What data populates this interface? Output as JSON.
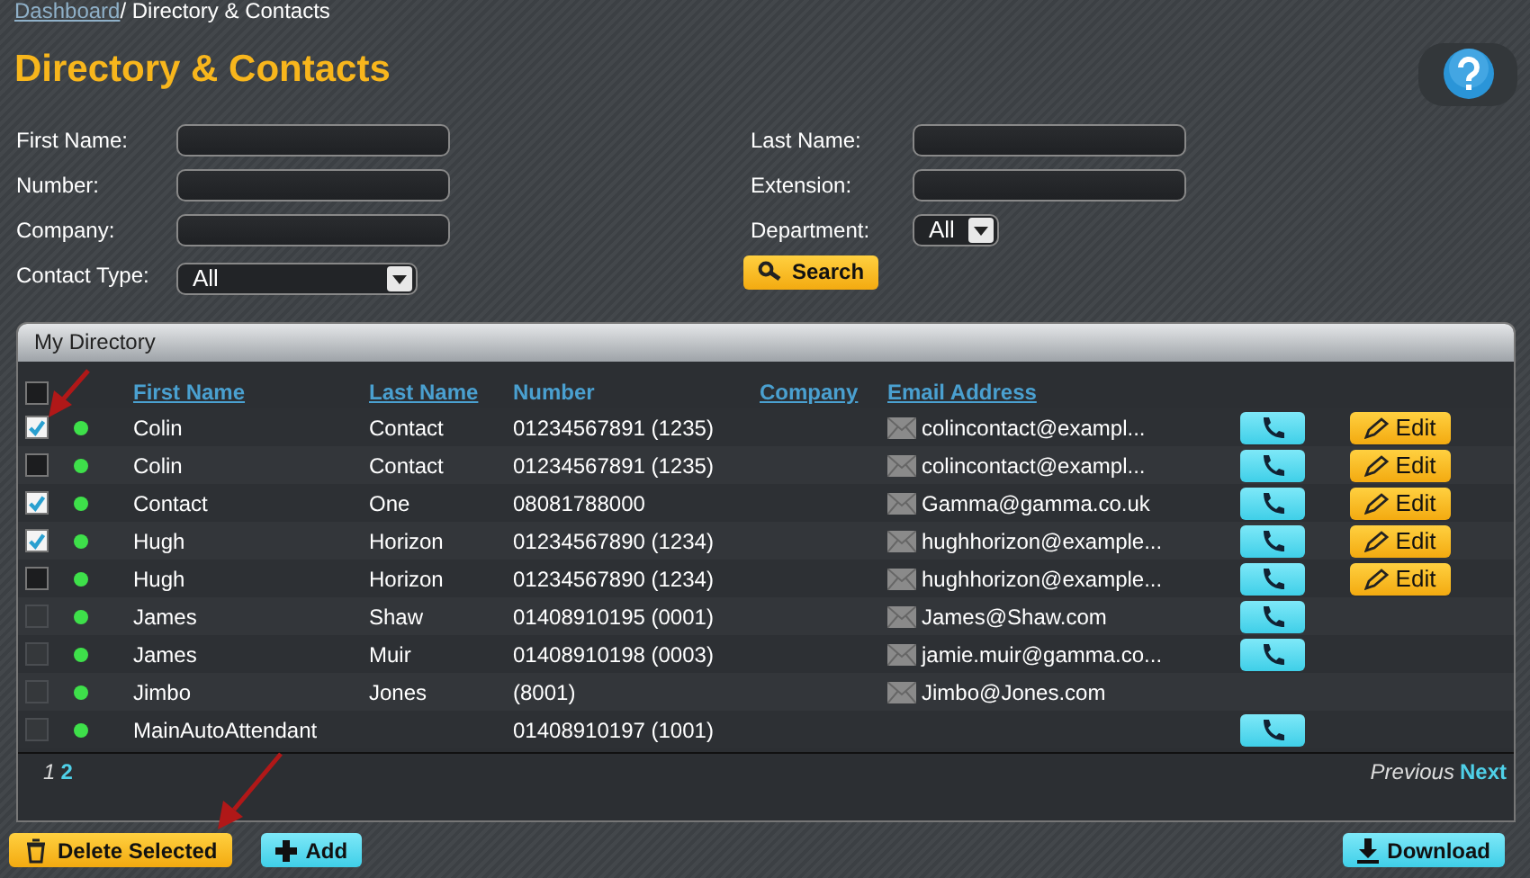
{
  "breadcrumb": {
    "link": "Dashboard",
    "current": "/ Directory & Contacts"
  },
  "title": "Directory & Contacts",
  "filters_left": [
    {
      "label": "First Name:",
      "kind": "text"
    },
    {
      "label": "Number:",
      "kind": "text"
    },
    {
      "label": "Company:",
      "kind": "text"
    },
    {
      "label": "Contact Type:",
      "kind": "select",
      "value": "All"
    }
  ],
  "filters_right": [
    {
      "label": "Last Name:",
      "kind": "text"
    },
    {
      "label": "Extension:",
      "kind": "text"
    },
    {
      "label": "Department:",
      "kind": "select",
      "value": "All"
    }
  ],
  "search_button": "Search",
  "panel": {
    "title": "My Directory",
    "select_all_checked": false,
    "columns": [
      {
        "label": "First Name",
        "link": true
      },
      {
        "label": "Last Name",
        "link": true
      },
      {
        "label": "Number",
        "link": false
      },
      {
        "label": "Company",
        "link": true
      },
      {
        "label": "Email Address",
        "link": true
      }
    ],
    "rows": [
      {
        "checked": true,
        "disabled": false,
        "online": true,
        "first": "Colin",
        "last": "Contact",
        "number": "01234567891 (1235)",
        "email": "colincontact@exampl...",
        "call": true,
        "edit": "Edit"
      },
      {
        "checked": false,
        "disabled": false,
        "online": true,
        "first": "Colin",
        "last": "Contact",
        "number": "01234567891 (1235)",
        "email": "colincontact@exampl...",
        "call": true,
        "edit": "Edit"
      },
      {
        "checked": true,
        "disabled": false,
        "online": true,
        "first": "Contact",
        "last": "One",
        "number": "08081788000",
        "email": "Gamma@gamma.co.uk",
        "call": true,
        "edit": "Edit"
      },
      {
        "checked": true,
        "disabled": false,
        "online": true,
        "first": "Hugh",
        "last": "Horizon",
        "number": "01234567890 (1234)",
        "email": "hughhorizon@example...",
        "call": true,
        "edit": "Edit"
      },
      {
        "checked": false,
        "disabled": false,
        "online": true,
        "first": "Hugh",
        "last": "Horizon",
        "number": "01234567890 (1234)",
        "email": "hughhorizon@example...",
        "call": true,
        "edit": "Edit"
      },
      {
        "checked": false,
        "disabled": true,
        "online": true,
        "first": "James",
        "last": "Shaw",
        "number": "01408910195 (0001)",
        "email": "James@Shaw.com",
        "call": true
      },
      {
        "checked": false,
        "disabled": true,
        "online": true,
        "first": "James",
        "last": "Muir",
        "number": "01408910198 (0003)",
        "email": "jamie.muir@gamma.co...",
        "call": true
      },
      {
        "checked": false,
        "disabled": true,
        "online": true,
        "first": "Jimbo",
        "last": "Jones",
        "number": "(8001)",
        "email": "Jimbo@Jones.com",
        "call": false
      },
      {
        "checked": false,
        "disabled": true,
        "online": true,
        "first": "MainAutoAttendant",
        "number": "01408910197 (1001)",
        "call": true
      }
    ],
    "pages": [
      {
        "label": "1",
        "selected": true
      },
      {
        "label": "2",
        "selected": false
      }
    ],
    "previous": {
      "label": "Previous",
      "disabled": true
    },
    "next": {
      "label": "Next",
      "disabled": false
    }
  },
  "actions": {
    "delete": "Delete Selected",
    "add": "Add",
    "download": "Download"
  }
}
